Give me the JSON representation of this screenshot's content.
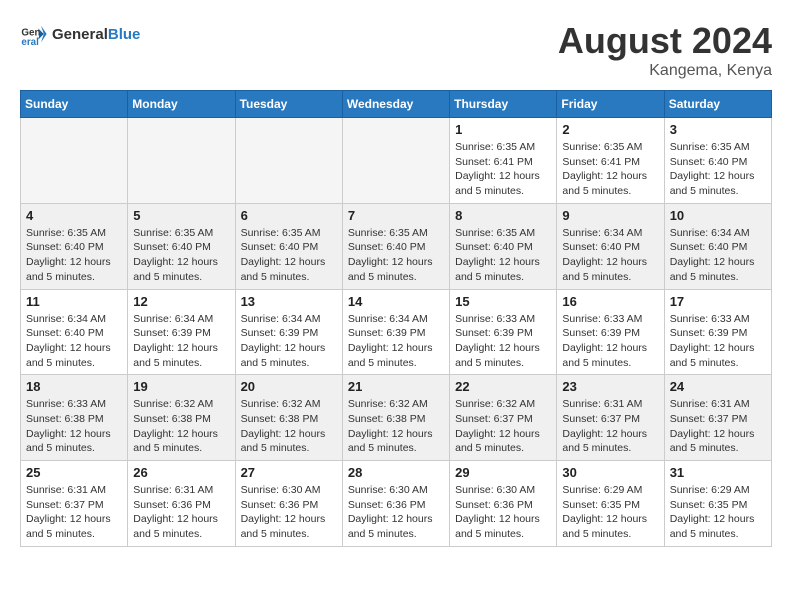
{
  "header": {
    "logo_text_general": "General",
    "logo_text_blue": "Blue",
    "month_title": "August 2024",
    "location": "Kangema, Kenya"
  },
  "weekdays": [
    "Sunday",
    "Monday",
    "Tuesday",
    "Wednesday",
    "Thursday",
    "Friday",
    "Saturday"
  ],
  "weeks": [
    [
      {
        "day": "",
        "info": ""
      },
      {
        "day": "",
        "info": ""
      },
      {
        "day": "",
        "info": ""
      },
      {
        "day": "",
        "info": ""
      },
      {
        "day": "1",
        "info": "Sunrise: 6:35 AM\nSunset: 6:41 PM\nDaylight: 12 hours and 5 minutes."
      },
      {
        "day": "2",
        "info": "Sunrise: 6:35 AM\nSunset: 6:41 PM\nDaylight: 12 hours and 5 minutes."
      },
      {
        "day": "3",
        "info": "Sunrise: 6:35 AM\nSunset: 6:40 PM\nDaylight: 12 hours and 5 minutes."
      }
    ],
    [
      {
        "day": "4",
        "info": "Sunrise: 6:35 AM\nSunset: 6:40 PM\nDaylight: 12 hours and 5 minutes."
      },
      {
        "day": "5",
        "info": "Sunrise: 6:35 AM\nSunset: 6:40 PM\nDaylight: 12 hours and 5 minutes."
      },
      {
        "day": "6",
        "info": "Sunrise: 6:35 AM\nSunset: 6:40 PM\nDaylight: 12 hours and 5 minutes."
      },
      {
        "day": "7",
        "info": "Sunrise: 6:35 AM\nSunset: 6:40 PM\nDaylight: 12 hours and 5 minutes."
      },
      {
        "day": "8",
        "info": "Sunrise: 6:35 AM\nSunset: 6:40 PM\nDaylight: 12 hours and 5 minutes."
      },
      {
        "day": "9",
        "info": "Sunrise: 6:34 AM\nSunset: 6:40 PM\nDaylight: 12 hours and 5 minutes."
      },
      {
        "day": "10",
        "info": "Sunrise: 6:34 AM\nSunset: 6:40 PM\nDaylight: 12 hours and 5 minutes."
      }
    ],
    [
      {
        "day": "11",
        "info": "Sunrise: 6:34 AM\nSunset: 6:40 PM\nDaylight: 12 hours and 5 minutes."
      },
      {
        "day": "12",
        "info": "Sunrise: 6:34 AM\nSunset: 6:39 PM\nDaylight: 12 hours and 5 minutes."
      },
      {
        "day": "13",
        "info": "Sunrise: 6:34 AM\nSunset: 6:39 PM\nDaylight: 12 hours and 5 minutes."
      },
      {
        "day": "14",
        "info": "Sunrise: 6:34 AM\nSunset: 6:39 PM\nDaylight: 12 hours and 5 minutes."
      },
      {
        "day": "15",
        "info": "Sunrise: 6:33 AM\nSunset: 6:39 PM\nDaylight: 12 hours and 5 minutes."
      },
      {
        "day": "16",
        "info": "Sunrise: 6:33 AM\nSunset: 6:39 PM\nDaylight: 12 hours and 5 minutes."
      },
      {
        "day": "17",
        "info": "Sunrise: 6:33 AM\nSunset: 6:39 PM\nDaylight: 12 hours and 5 minutes."
      }
    ],
    [
      {
        "day": "18",
        "info": "Sunrise: 6:33 AM\nSunset: 6:38 PM\nDaylight: 12 hours and 5 minutes."
      },
      {
        "day": "19",
        "info": "Sunrise: 6:32 AM\nSunset: 6:38 PM\nDaylight: 12 hours and 5 minutes."
      },
      {
        "day": "20",
        "info": "Sunrise: 6:32 AM\nSunset: 6:38 PM\nDaylight: 12 hours and 5 minutes."
      },
      {
        "day": "21",
        "info": "Sunrise: 6:32 AM\nSunset: 6:38 PM\nDaylight: 12 hours and 5 minutes."
      },
      {
        "day": "22",
        "info": "Sunrise: 6:32 AM\nSunset: 6:37 PM\nDaylight: 12 hours and 5 minutes."
      },
      {
        "day": "23",
        "info": "Sunrise: 6:31 AM\nSunset: 6:37 PM\nDaylight: 12 hours and 5 minutes."
      },
      {
        "day": "24",
        "info": "Sunrise: 6:31 AM\nSunset: 6:37 PM\nDaylight: 12 hours and 5 minutes."
      }
    ],
    [
      {
        "day": "25",
        "info": "Sunrise: 6:31 AM\nSunset: 6:37 PM\nDaylight: 12 hours and 5 minutes."
      },
      {
        "day": "26",
        "info": "Sunrise: 6:31 AM\nSunset: 6:36 PM\nDaylight: 12 hours and 5 minutes."
      },
      {
        "day": "27",
        "info": "Sunrise: 6:30 AM\nSunset: 6:36 PM\nDaylight: 12 hours and 5 minutes."
      },
      {
        "day": "28",
        "info": "Sunrise: 6:30 AM\nSunset: 6:36 PM\nDaylight: 12 hours and 5 minutes."
      },
      {
        "day": "29",
        "info": "Sunrise: 6:30 AM\nSunset: 6:36 PM\nDaylight: 12 hours and 5 minutes."
      },
      {
        "day": "30",
        "info": "Sunrise: 6:29 AM\nSunset: 6:35 PM\nDaylight: 12 hours and 5 minutes."
      },
      {
        "day": "31",
        "info": "Sunrise: 6:29 AM\nSunset: 6:35 PM\nDaylight: 12 hours and 5 minutes."
      }
    ]
  ]
}
